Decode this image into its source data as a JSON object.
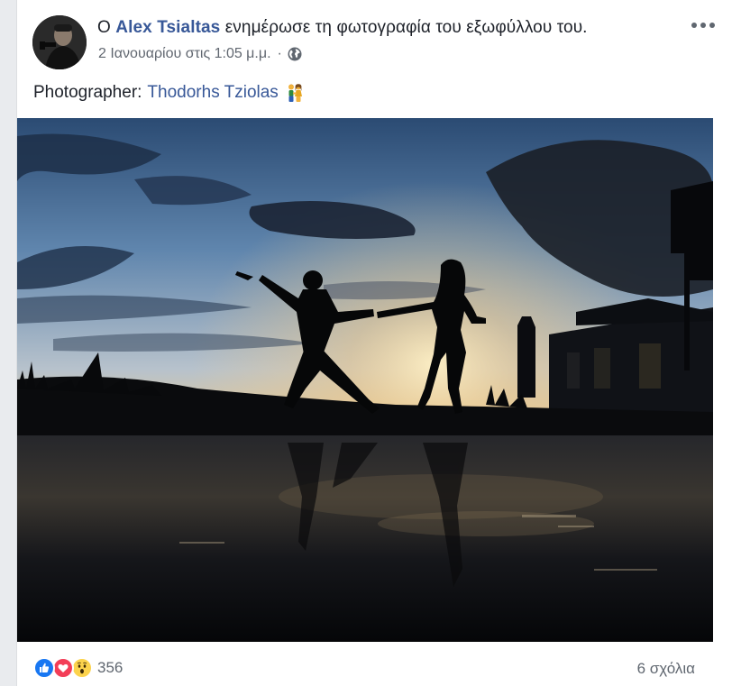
{
  "post": {
    "prefix": "Ο",
    "author": "Alex Tsialtas",
    "action": "ενημέρωσε τη φωτογραφία του εξωφύλλου του.",
    "timestamp": "2 Ιανουαρίου στις 1:05 μ.μ.",
    "separator": "·",
    "privacy_icon": "globe-icon",
    "more_icon": "more-options-icon"
  },
  "caption": {
    "label": "Photographer:",
    "credit": "Thodorhs Tziolas",
    "emoji_icon": "couple-holding-hands-icon"
  },
  "photo": {
    "description_icon": "cover-photo"
  },
  "footer": {
    "reaction_icons": [
      "like-icon",
      "love-icon",
      "wow-icon"
    ],
    "reaction_count": "356",
    "comments": "6 σχόλια"
  },
  "colors": {
    "link": "#385898",
    "text": "#1d2129",
    "meta": "#616770",
    "like": "#1877f2",
    "love": "#f33e58",
    "wow": "#fcd34d"
  }
}
